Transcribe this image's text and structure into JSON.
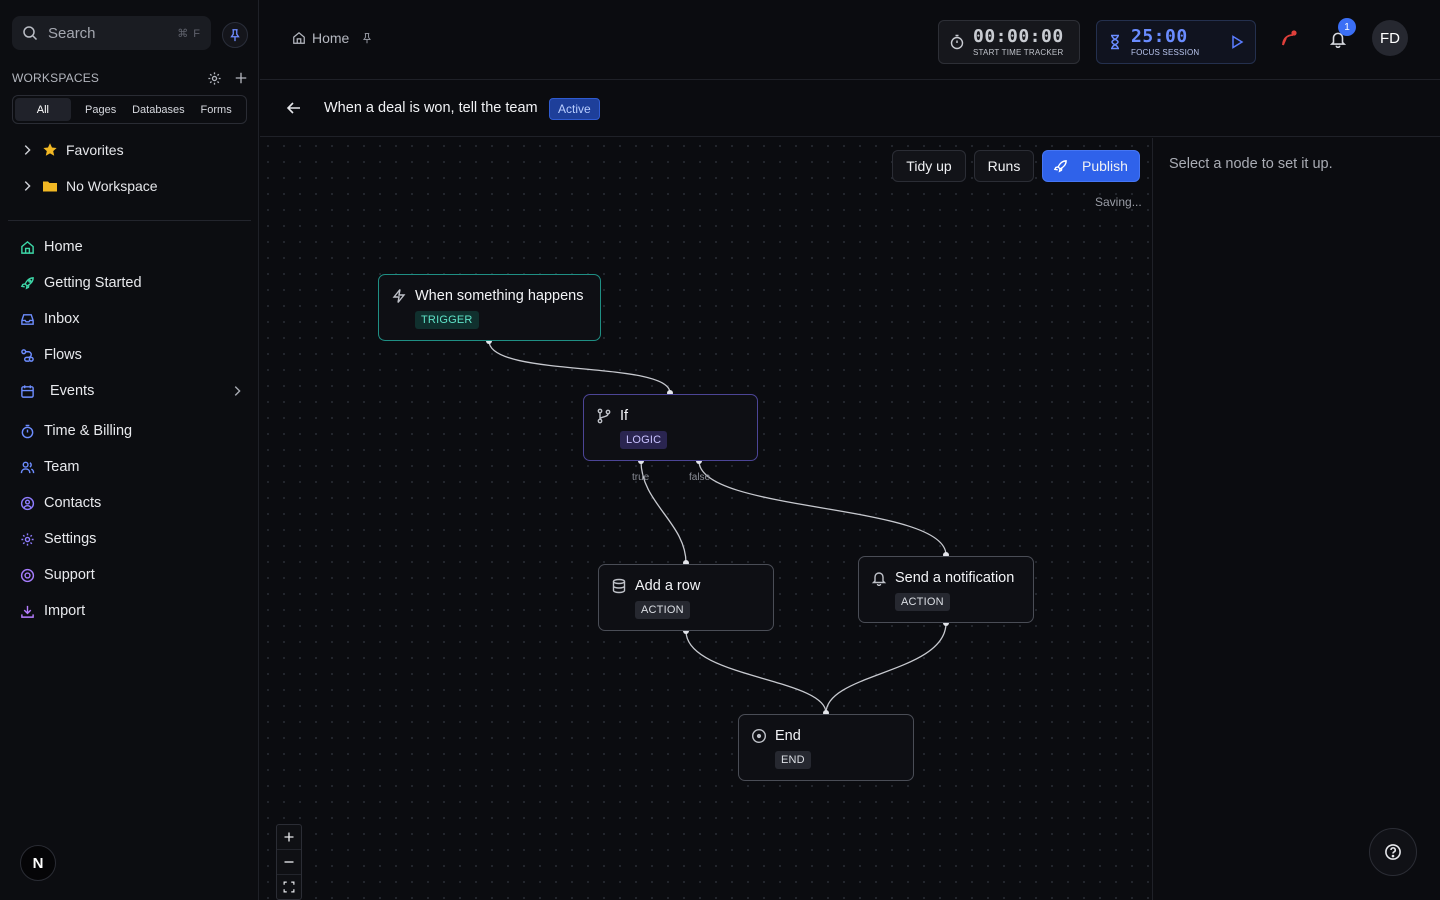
{
  "sidebar": {
    "search": {
      "placeholder": "Search",
      "shortcut": "⌘ F"
    },
    "workspaces_label": "WORKSPACES",
    "filters": [
      "All",
      "Pages",
      "Databases",
      "Forms"
    ],
    "tree": [
      {
        "label": "Favorites",
        "icon": "star-icon"
      },
      {
        "label": "No Workspace",
        "icon": "folder-icon"
      }
    ],
    "nav": [
      {
        "label": "Home",
        "icon": "home-icon"
      },
      {
        "label": "Getting Started",
        "icon": "rocket-icon"
      },
      {
        "label": "Inbox",
        "icon": "inbox-icon"
      },
      {
        "label": "Flows",
        "icon": "flows-icon"
      },
      {
        "label": "Events",
        "icon": "calendar-icon"
      },
      {
        "label": "Time & Billing",
        "icon": "timer-icon"
      },
      {
        "label": "Team",
        "icon": "team-icon"
      },
      {
        "label": "Contacts",
        "icon": "contacts-icon"
      },
      {
        "label": "Settings",
        "icon": "gear-icon"
      },
      {
        "label": "Support",
        "icon": "support-icon"
      },
      {
        "label": "Import",
        "icon": "import-icon"
      }
    ],
    "bottom_badge": "N"
  },
  "topbar": {
    "breadcrumb": "Home",
    "tracker": {
      "time": "00:00:00",
      "caption": "START TIME TRACKER"
    },
    "focus": {
      "time": "25:00",
      "caption": "FOCUS SESSION"
    },
    "notification_count": "1",
    "avatar_initials": "FD"
  },
  "flow": {
    "title": "When a deal is won, tell the team",
    "status": "Active",
    "buttons": {
      "tidy": "Tidy up",
      "runs": "Runs",
      "publish": "Publish"
    },
    "saving": "Saving...",
    "nodes": {
      "trigger": {
        "title": "When something happens",
        "tag": "TRIGGER"
      },
      "logic": {
        "title": "If",
        "tag": "LOGIC"
      },
      "add_row": {
        "title": "Add a row",
        "tag": "ACTION"
      },
      "notify": {
        "title": "Send a notification",
        "tag": "ACTION"
      },
      "end": {
        "title": "End",
        "tag": "END"
      }
    },
    "ports": {
      "true": "true",
      "false": "false"
    }
  },
  "panel": {
    "hint": "Select a node to set it up."
  },
  "colors": {
    "accent": "#2f62ea",
    "trigger": "#1f8f84",
    "logic": "#4c4596"
  }
}
